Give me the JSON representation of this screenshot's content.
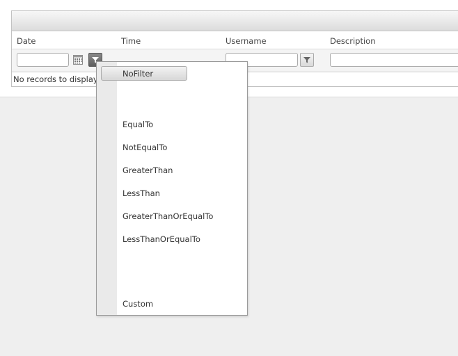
{
  "grid": {
    "columns": [
      "Date",
      "Time",
      "Username",
      "Description"
    ],
    "empty_message": "No records to display."
  },
  "filter": {
    "date_value": "",
    "username_value": "",
    "description_value": ""
  },
  "filter_menu": {
    "selected": "NoFilter",
    "items": [
      "NoFilter",
      "EqualTo",
      "NotEqualTo",
      "GreaterThan",
      "LessThan",
      "GreaterThanOrEqualTo",
      "LessThanOrEqualTo",
      "Custom"
    ]
  },
  "icons": {
    "calendar": "calendar-icon",
    "filter": "filter-funnel-icon"
  },
  "colors": {
    "active_filter_button": "#6e6e6e",
    "background": "#efefef"
  }
}
